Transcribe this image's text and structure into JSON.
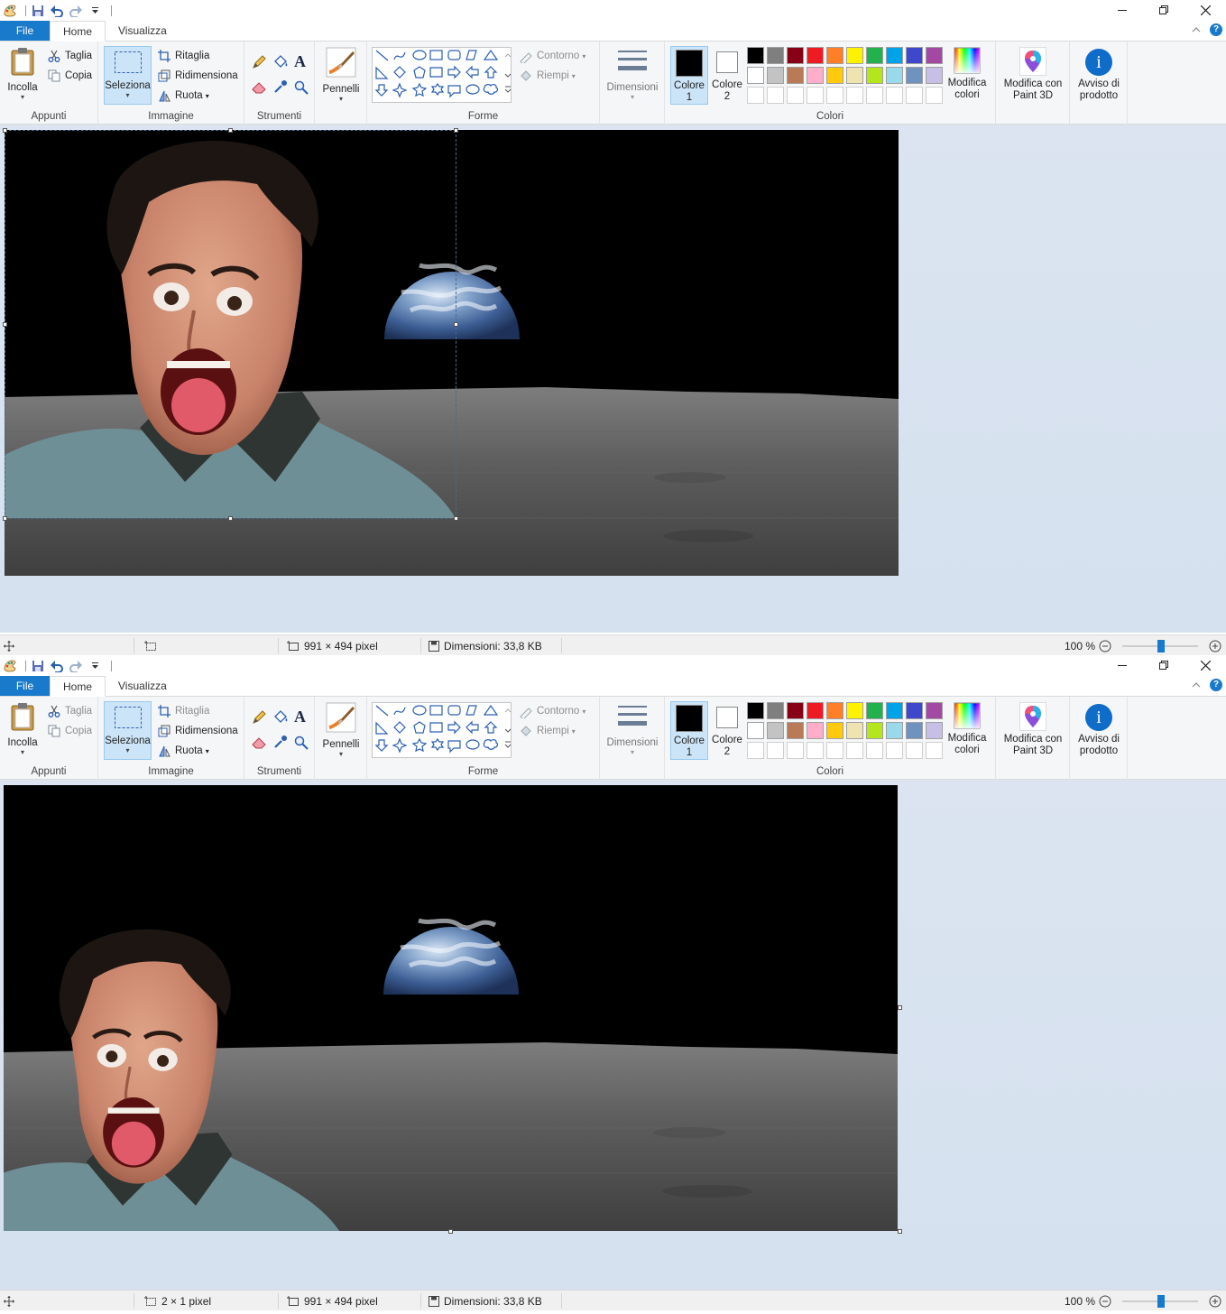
{
  "tabs": {
    "file": "File",
    "home": "Home",
    "view": "Visualizza"
  },
  "help_label": "?",
  "groups": {
    "clipboard": {
      "label": "Appunti",
      "paste": "Incolla",
      "cut": "Taglia",
      "copy": "Copia"
    },
    "image": {
      "label": "Immagine",
      "select": "Seleziona",
      "crop": "Ritaglia",
      "resize": "Ridimensiona",
      "rotate": "Ruota"
    },
    "tools": {
      "label": "Strumenti",
      "pencil_letter": "A"
    },
    "brushes": {
      "label": "Pennelli"
    },
    "shapes": {
      "label": "Forme",
      "outline": "Contorno",
      "fill": "Riempi"
    },
    "size": {
      "label": "Dimensioni"
    },
    "colors": {
      "label": "Colori",
      "color1_l1": "Colore",
      "color1_l2": "1",
      "color2_l1": "Colore",
      "color2_l2": "2",
      "edit_l1": "Modifica",
      "edit_l2": "colori",
      "color1_value": "#000000",
      "color2_value": "#ffffff"
    },
    "paint3d": {
      "l1": "Modifica con",
      "l2": "Paint 3D"
    },
    "notice": {
      "l1": "Avviso di",
      "l2": "prodotto",
      "icon": "i"
    }
  },
  "palette": {
    "row1": [
      "#000000",
      "#7f7f7f",
      "#880015",
      "#ed1c24",
      "#ff7f27",
      "#fff200",
      "#22b14c",
      "#00a2e8",
      "#3f48cc",
      "#a349a4"
    ],
    "row2": [
      "#ffffff",
      "#c3c3c3",
      "#b97a57",
      "#ffaec9",
      "#ffc90e",
      "#efe4b0",
      "#b5e61d",
      "#99d9ea",
      "#7092be",
      "#c8bfe7"
    ],
    "row3": [
      "#ffffff",
      "#ffffff",
      "#ffffff",
      "#ffffff",
      "#ffffff",
      "#ffffff",
      "#ffffff",
      "#ffffff",
      "#ffffff",
      "#ffffff"
    ]
  },
  "status1": {
    "selection": "",
    "image_size": "991 × 494 pixel",
    "file_size": "Dimensioni: 33,8 KB",
    "zoom": "100 %"
  },
  "status2": {
    "selection": "2 × 1 pixel",
    "image_size": "991 × 494 pixel",
    "file_size": "Dimensioni: 33,8 KB",
    "zoom": "100 %"
  }
}
